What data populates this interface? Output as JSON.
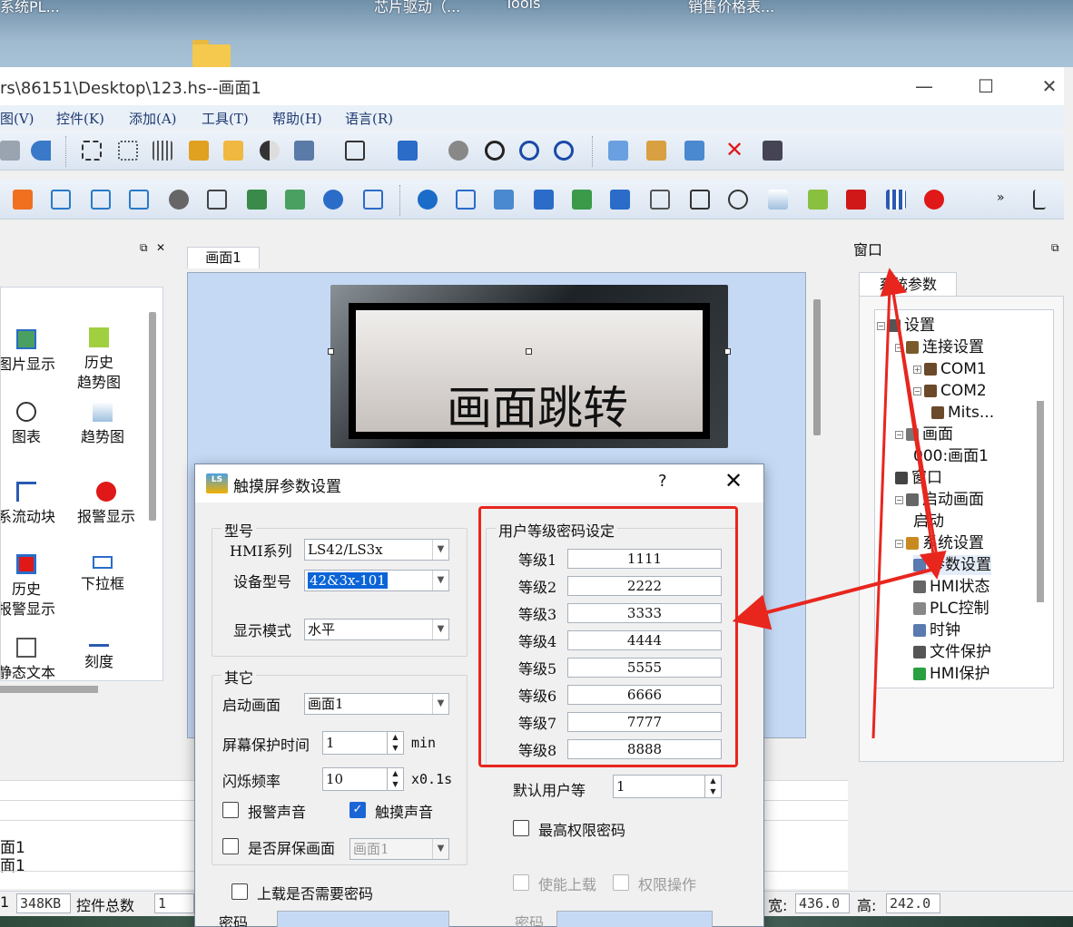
{
  "desktop": {
    "labels": [
      "系统PL...",
      "芯片驱动（...",
      "Tools",
      "销售价格表..."
    ]
  },
  "window": {
    "title": "rs\\86151\\Desktop\\123.hs--画面1",
    "minimize": "—",
    "maximize": "☐",
    "close": "✕"
  },
  "menu": [
    "图(V)",
    "控件(K)",
    "添加(A)",
    "工具(T)",
    "帮助(H)",
    "语言(R)"
  ],
  "toolbar": {
    "more": "»"
  },
  "left_panel": {
    "pin": "📌",
    "close": "✕",
    "items": [
      {
        "label": "图片显示",
        "icon": "image-icon"
      },
      {
        "label": "历史\n趋势图",
        "icon": "history-trend-icon"
      },
      {
        "label": "图表",
        "icon": "gauge-icon"
      },
      {
        "label": "趋势图",
        "icon": "trend-chart-icon"
      },
      {
        "label": "系流动块",
        "icon": "flow-block-icon"
      },
      {
        "label": "报警显示",
        "icon": "alarm-icon"
      },
      {
        "label": "历史\n报警显示",
        "icon": "history-alarm-icon"
      },
      {
        "label": "下拉框",
        "icon": "dropdown-icon"
      },
      {
        "label": "静态文本",
        "icon": "static-text-icon"
      },
      {
        "label": "刻度",
        "icon": "ruler-icon"
      }
    ]
  },
  "canvas": {
    "tab": "画面1",
    "button_label": "画面跳转"
  },
  "right_panel": {
    "header": "窗口",
    "pin": "📌",
    "close": "✕",
    "tab": "系统参数",
    "tree": [
      {
        "label": "设置",
        "level": 0,
        "exp": "−",
        "icon": "settings-icon"
      },
      {
        "label": "连接设置",
        "level": 1,
        "exp": "−",
        "icon": "connection-icon"
      },
      {
        "label": "COM1",
        "level": 2,
        "exp": "+",
        "icon": "port-icon"
      },
      {
        "label": "COM2",
        "level": 2,
        "exp": "−",
        "icon": "port-icon"
      },
      {
        "label": "Mits...",
        "level": 3,
        "exp": "",
        "icon": "device-icon"
      },
      {
        "label": "画面",
        "level": 1,
        "exp": "−",
        "icon": "screens-icon"
      },
      {
        "label": "000:画面1",
        "level": 2,
        "exp": "",
        "icon": ""
      },
      {
        "label": "窗口",
        "level": 1,
        "exp": "",
        "icon": "window-icon"
      },
      {
        "label": "启动画面",
        "level": 1,
        "exp": "−",
        "icon": "startup-icon"
      },
      {
        "label": "启动",
        "level": 2,
        "exp": "",
        "icon": ""
      },
      {
        "label": "系统设置",
        "level": 1,
        "exp": "−",
        "icon": "system-settings-icon"
      },
      {
        "label": "参数设置",
        "level": 2,
        "exp": "",
        "icon": "parameter-icon",
        "selected": true
      },
      {
        "label": "HMI状态",
        "level": 2,
        "exp": "",
        "icon": "hmi-status-icon"
      },
      {
        "label": "PLC控制",
        "level": 2,
        "exp": "",
        "icon": "plc-control-icon"
      },
      {
        "label": "时钟",
        "level": 2,
        "exp": "",
        "icon": "clock-icon"
      },
      {
        "label": "文件保护",
        "level": 2,
        "exp": "",
        "icon": "lock-icon"
      },
      {
        "label": "HMI保护",
        "level": 2,
        "exp": "",
        "icon": "shield-icon"
      }
    ]
  },
  "output": {
    "lines": [
      "面1",
      "面1"
    ]
  },
  "statusbar": {
    "size_label": "1",
    "size_value": "348KB",
    "count_label": "控件总数",
    "count_value": "1",
    "width_label": "宽:",
    "width_value": "436.0",
    "height_label": "高:",
    "height_value": "242.0"
  },
  "dialog": {
    "logo": "LS",
    "title": "触摸屏参数设置",
    "help": "?",
    "close": "✕",
    "model_group": "型号",
    "hmi_series_label": "HMI系列",
    "hmi_series_value": "LS42/LS3x",
    "device_model_label": "设备型号",
    "device_model_value": "42&3x-101",
    "display_mode_label": "显示模式",
    "display_mode_value": "水平",
    "other_group": "其它",
    "startup_screen_label": "启动画面",
    "startup_screen_value": "画面1",
    "screensaver_time_label": "屏幕保护时间",
    "screensaver_time_value": "1",
    "screensaver_time_unit": "min",
    "blink_freq_label": "闪烁频率",
    "blink_freq_value": "10",
    "blink_freq_unit": "x0.1s",
    "alarm_sound_label": "报警声音",
    "alarm_sound_checked": false,
    "touch_sound_label": "触摸声音",
    "touch_sound_checked": true,
    "screensaver_label": "是否屏保画面",
    "screensaver_screen_value": "画面1",
    "upload_password_label": "上载是否需要密码",
    "password_label": "密码",
    "level_group": "用户等级密码设定",
    "levels": [
      {
        "label": "等级1",
        "value": "1111"
      },
      {
        "label": "等级2",
        "value": "2222"
      },
      {
        "label": "等级3",
        "value": "3333"
      },
      {
        "label": "等级4",
        "value": "4444"
      },
      {
        "label": "等级5",
        "value": "5555"
      },
      {
        "label": "等级6",
        "value": "6666"
      },
      {
        "label": "等级7",
        "value": "7777"
      },
      {
        "label": "等级8",
        "value": "8888"
      }
    ],
    "default_user_label": "默认用户等",
    "default_user_value": "1",
    "top_password_label": "最高权限密码",
    "enable_upload_label": "使能上载",
    "permission_op_label": "权限操作",
    "password2_label": "密码"
  },
  "colors": {
    "annotation_red": "#e8261e",
    "selection_blue": "#0a64d8",
    "canvas_bg": "#c5d9f5"
  }
}
